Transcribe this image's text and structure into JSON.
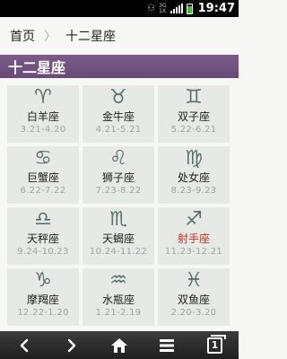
{
  "status_bar": {
    "network_type": "3G",
    "network_label_top": "3G",
    "network_label_bottom": "1X",
    "battery_level": 0.78,
    "time": "19:47"
  },
  "breadcrumb": {
    "home": "首页",
    "separator": "〉",
    "current": "十二星座"
  },
  "page_title": "十二星座",
  "signs": [
    {
      "glyph": "♈",
      "icon": "aries-icon",
      "name": "白羊座",
      "dates": "3.21-4.20"
    },
    {
      "glyph": "♉",
      "icon": "taurus-icon",
      "name": "金牛座",
      "dates": "4.21-5.21"
    },
    {
      "glyph": "♊",
      "icon": "gemini-icon",
      "name": "双子座",
      "dates": "5.22-6.21"
    },
    {
      "glyph": "♋",
      "icon": "cancer-icon",
      "name": "巨蟹座",
      "dates": "6.22-7.22"
    },
    {
      "glyph": "♌",
      "icon": "leo-icon",
      "name": "狮子座",
      "dates": "7.23-8.22"
    },
    {
      "glyph": "♍",
      "icon": "virgo-icon",
      "name": "处女座",
      "dates": "8.23-9.23"
    },
    {
      "glyph": "♎",
      "icon": "libra-icon",
      "name": "天秤座",
      "dates": "9.24-10.23"
    },
    {
      "glyph": "♏",
      "icon": "scorpio-icon",
      "name": "天蝎座",
      "dates": "10.24-11.22"
    },
    {
      "glyph": "♐",
      "icon": "sagittarius-icon",
      "name": "射手座",
      "dates": "11.23-12.21",
      "highlight": true
    },
    {
      "glyph": "♑",
      "icon": "capricorn-icon",
      "name": "摩羯座",
      "dates": "12.22-1.20"
    },
    {
      "glyph": "♒",
      "icon": "aquarius-icon",
      "name": "水瓶座",
      "dates": "1.21-2.19"
    },
    {
      "glyph": "♓",
      "icon": "pisces-icon",
      "name": "双鱼座",
      "dates": "2.20-3.20"
    }
  ],
  "toolbar": {
    "tab_count": "1",
    "buttons": [
      "back-icon",
      "forward-icon",
      "home-icon",
      "menu-icon",
      "tabs-icon"
    ]
  },
  "colors": {
    "title_bar": "#6f4f7d",
    "sign_icon": "#5a7070",
    "highlight_text": "#c0321e"
  }
}
